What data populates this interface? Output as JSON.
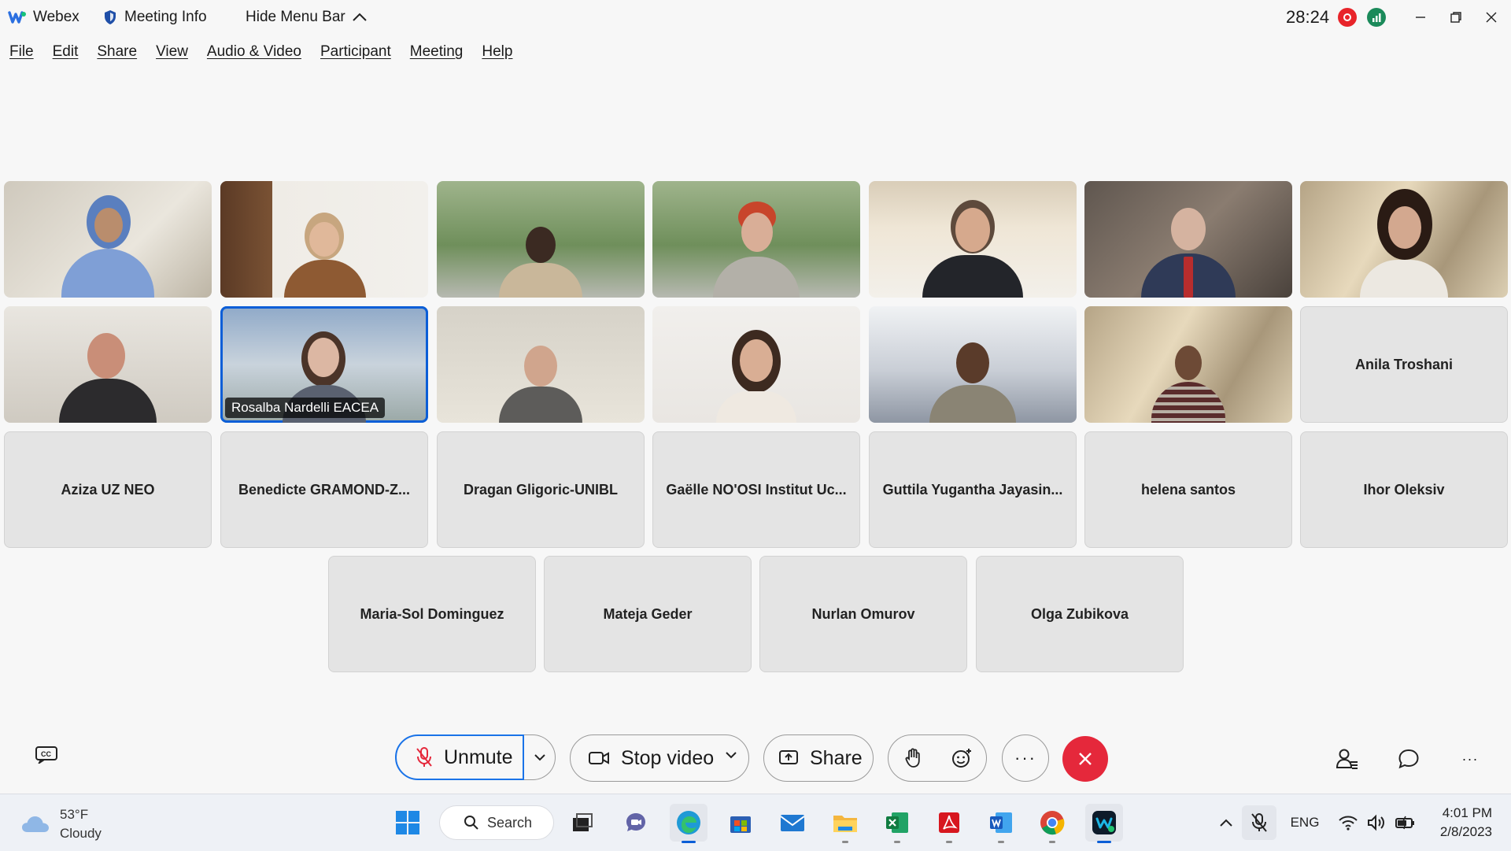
{
  "window": {
    "app_name": "Webex",
    "meeting_info": "Meeting Info",
    "hide_menu_bar": "Hide Menu Bar",
    "timer": "28:24"
  },
  "menu": [
    "File",
    "Edit",
    "Share",
    "View",
    "Audio & Video",
    "Participant",
    "Meeting",
    "Help"
  ],
  "video_tiles": {
    "active_speaker_label": "Rosalba Nardelli EACEA"
  },
  "name_tiles": [
    "Anila Troshani",
    "Aziza UZ NEO",
    "Benedicte GRAMOND-Z...",
    "Dragan Gligoric-UNIBL",
    "Gaëlle NO'OSI Institut Uc...",
    "Guttila Yugantha Jayasin...",
    "helena santos",
    "Ihor Oleksiv",
    "Maria-Sol Dominguez",
    "Mateja Geder",
    "Nurlan Omurov",
    "Olga Zubikova"
  ],
  "controls": {
    "unmute": "Unmute",
    "stop_video": "Stop video",
    "share": "Share",
    "more": "···"
  },
  "taskbar": {
    "weather_temp": "53°F",
    "weather_desc": "Cloudy",
    "search": "Search",
    "language": "ENG",
    "time": "4:01 PM",
    "date": "2/8/2023"
  },
  "colors": {
    "active_border": "#0b5ed7",
    "end_call": "#e5283b",
    "recording": "#e8242a"
  }
}
